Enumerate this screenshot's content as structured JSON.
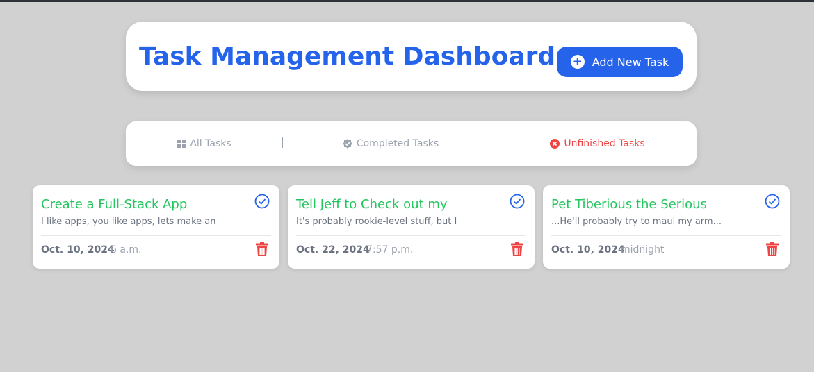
{
  "app": {
    "title": "Task Management Dashboard"
  },
  "header": {
    "add_button_label": "Add New Task",
    "add_icon": "plus-circle-icon"
  },
  "filters": [
    {
      "label": "All Tasks",
      "icon": "grid-icon",
      "active": false
    },
    {
      "label": "Completed Tasks",
      "icon": "check-badge-icon",
      "active": false
    },
    {
      "label": "Unfinished Tasks",
      "icon": "x-circle-icon",
      "active": true
    }
  ],
  "tasks": [
    {
      "title": "Create a Full-Stack App",
      "description": "I like apps, you like apps, lets make an",
      "date": "Oct. 10, 2024",
      "time": "6 a.m."
    },
    {
      "title": "Tell Jeff to Check out my",
      "description": "It's probably rookie-level stuff, but I",
      "date": "Oct. 22, 2024",
      "time": "7:57 p.m."
    },
    {
      "title": "Pet Tiberious the Serious",
      "description": "...He'll probably try to maul my arm...",
      "date": "Oct. 10, 2024",
      "time": "midnight"
    }
  ],
  "colors": {
    "accent": "#2563eb",
    "task_title": "#22c55e",
    "danger": "#ef4444",
    "muted": "#9ca3af",
    "background": "#d1d1d1"
  }
}
